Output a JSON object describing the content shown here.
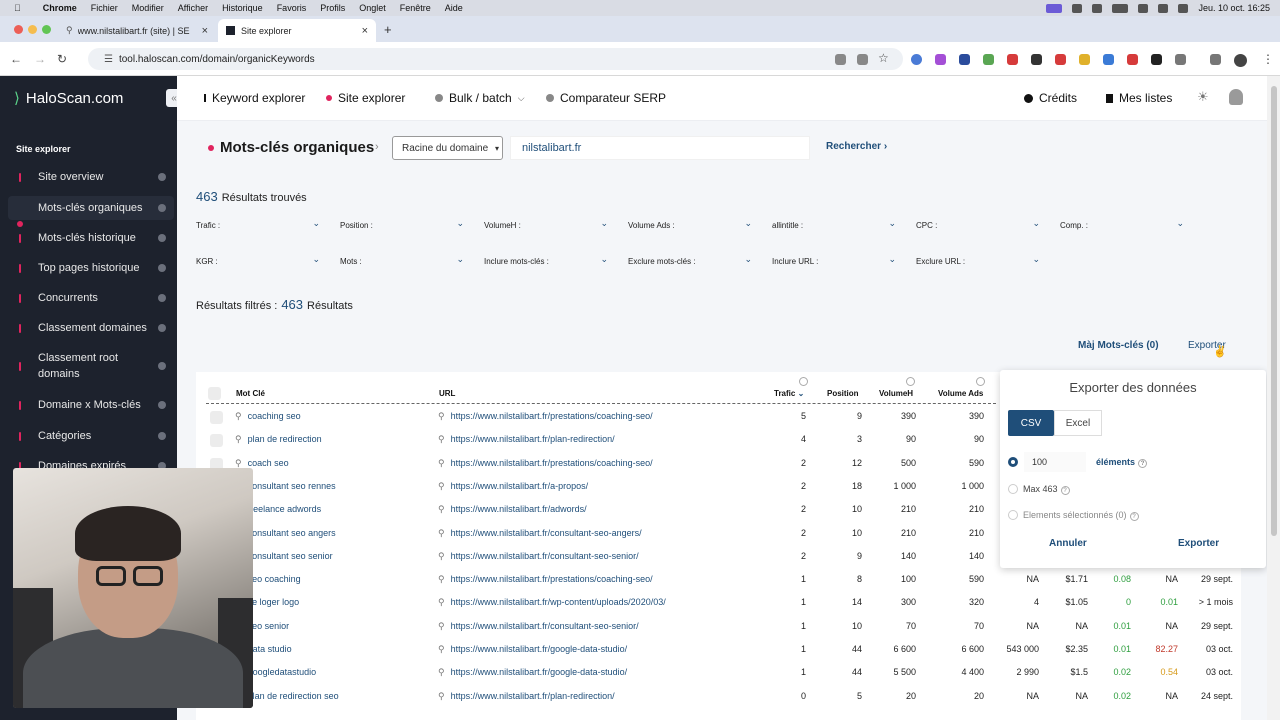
{
  "menubar": {
    "app": "Chrome",
    "items": [
      "Fichier",
      "Modifier",
      "Afficher",
      "Historique",
      "Favoris",
      "Profils",
      "Onglet",
      "Fenêtre",
      "Aide"
    ],
    "clock": "Jeu. 10 oct.  16:25"
  },
  "browser": {
    "tabs": [
      {
        "title": "www.nilstalibart.fr (site) | SEO"
      },
      {
        "title": "Site explorer"
      }
    ],
    "url": "tool.haloscan.com/domain/organicKeywords"
  },
  "sidebar": {
    "logo": "HaloScan.com",
    "section_title": "Site explorer",
    "items": [
      {
        "label": "Site overview"
      },
      {
        "label": "Mots-clés organiques"
      },
      {
        "label": "Mots-clés historique"
      },
      {
        "label": "Top pages historique"
      },
      {
        "label": "Concurrents"
      },
      {
        "label": "Classement domaines"
      },
      {
        "label": "Classement root domains"
      },
      {
        "label": "Domaine x Mots-clés"
      },
      {
        "label": "Catégories"
      },
      {
        "label": "Domaines expirés"
      }
    ]
  },
  "topnav": {
    "keyword_explorer": "Keyword explorer",
    "site_explorer": "Site explorer",
    "bulk": "Bulk / batch",
    "serp": "Comparateur SERP",
    "credits": "Crédits",
    "lists": "Mes listes"
  },
  "page": {
    "title": "Mots-clés organiques",
    "root_select": "Racine du domaine",
    "domain": "nilstalibart.fr",
    "search_label": "Rechercher",
    "results_count": "463",
    "results_label": "Résultats trouvés",
    "filtered_label": "Résultats filtrés :",
    "filtered_count": "463",
    "filtered_suffix": "Résultats",
    "maj_label": "Màj Mots-clés (0)",
    "export_label": "Exporter"
  },
  "filters": [
    "Trafic :",
    "Position :",
    "VolumeH :",
    "Volume Ads :",
    "allintitle :",
    "CPC :",
    "Comp. :",
    "KGR :",
    "Mots :",
    "Inclure mots-clés :",
    "Exclure mots-clés :",
    "Inclure URL :",
    "Exclure URL :"
  ],
  "table": {
    "headers": {
      "keyword": "Mot Clé",
      "url": "URL",
      "traffic": "Trafic",
      "position": "Position",
      "volumeh": "VolumeH",
      "volume_ads": "Volume Ads"
    },
    "rows": [
      {
        "kw": "coaching seo",
        "url": "https://www.nilstalibart.fr/prestations/coaching-seo/",
        "traffic": "5",
        "pos": "9",
        "vh": "390",
        "va": "390",
        "c1": "",
        "c2": "",
        "c3": "",
        "c4": "",
        "c5": "",
        "c6": ""
      },
      {
        "kw": "plan de redirection",
        "url": "https://www.nilstalibart.fr/plan-redirection/",
        "traffic": "4",
        "pos": "3",
        "vh": "90",
        "va": "90",
        "c1": "",
        "c2": "",
        "c3": "",
        "c4": "",
        "c5": "",
        "c6": ""
      },
      {
        "kw": "coach seo",
        "url": "https://www.nilstalibart.fr/prestations/coaching-seo/",
        "traffic": "2",
        "pos": "12",
        "vh": "500",
        "va": "590",
        "c1": "",
        "c2": "",
        "c3": "",
        "c4": "",
        "c5": "",
        "c6": ""
      },
      {
        "kw": "consultant seo rennes",
        "url": "https://www.nilstalibart.fr/a-propos/",
        "traffic": "2",
        "pos": "18",
        "vh": "1 000",
        "va": "1 000",
        "c1": "",
        "c2": "",
        "c3": "",
        "c4": "",
        "c5": "",
        "c6": ""
      },
      {
        "kw": "freelance adwords",
        "url": "https://www.nilstalibart.fr/adwords/",
        "traffic": "2",
        "pos": "10",
        "vh": "210",
        "va": "210",
        "c1": "",
        "c2": "",
        "c3": "",
        "c4": "",
        "c5": "",
        "c6": ""
      },
      {
        "kw": "consultant seo angers",
        "url": "https://www.nilstalibart.fr/consultant-seo-angers/",
        "traffic": "2",
        "pos": "10",
        "vh": "210",
        "va": "210",
        "c1": "",
        "c2": "",
        "c3": "",
        "c4": "",
        "c5": "",
        "c6": ""
      },
      {
        "kw": "consultant seo senior",
        "url": "https://www.nilstalibart.fr/consultant-seo-senior/",
        "traffic": "2",
        "pos": "9",
        "vh": "140",
        "va": "140",
        "c1": "",
        "c2": "",
        "c3": "",
        "c4": "",
        "c5": "",
        "c6": ""
      },
      {
        "kw": "seo coaching",
        "url": "https://www.nilstalibart.fr/prestations/coaching-seo/",
        "traffic": "1",
        "pos": "8",
        "vh": "100",
        "va": "590",
        "c1": "NA",
        "c2": "$1.71",
        "c3": "0.08",
        "c4": "NA",
        "c5": "29 sept.",
        "c6": ""
      },
      {
        "kw": "se loger logo",
        "url": "https://www.nilstalibart.fr/wp-content/uploads/2020/03/",
        "traffic": "1",
        "pos": "14",
        "vh": "300",
        "va": "320",
        "c1": "4",
        "c2": "$1.05",
        "c3": "0",
        "c4": "0.01",
        "c5": "> 1 mois",
        "c6": ""
      },
      {
        "kw": "seo senior",
        "url": "https://www.nilstalibart.fr/consultant-seo-senior/",
        "traffic": "1",
        "pos": "10",
        "vh": "70",
        "va": "70",
        "c1": "NA",
        "c2": "NA",
        "c3": "0.01",
        "c4": "NA",
        "c5": "29 sept.",
        "c6": ""
      },
      {
        "kw": "data studio",
        "url": "https://www.nilstalibart.fr/google-data-studio/",
        "traffic": "1",
        "pos": "44",
        "vh": "6 600",
        "va": "6 600",
        "c1": "543 000",
        "c2": "$2.35",
        "c3": "0.01",
        "c4": "82.27",
        "c5": "03 oct.",
        "c6": ""
      },
      {
        "kw": "googledatastudio",
        "url": "https://www.nilstalibart.fr/google-data-studio/",
        "traffic": "1",
        "pos": "44",
        "vh": "5 500",
        "va": "4 400",
        "c1": "2 990",
        "c2": "$1.5",
        "c3": "0.02",
        "c4": "0.54",
        "c5": "03 oct.",
        "c6": ""
      },
      {
        "kw": "plan de redirection seo",
        "url": "https://www.nilstalibart.fr/plan-redirection/",
        "traffic": "0",
        "pos": "5",
        "vh": "20",
        "va": "20",
        "c1": "NA",
        "c2": "NA",
        "c3": "0.02",
        "c4": "NA",
        "c5": "24 sept.",
        "c6": ""
      }
    ]
  },
  "export_popover": {
    "title": "Exporter des données",
    "csv": "CSV",
    "excel": "Excel",
    "count": "100",
    "elements_label": "éléments",
    "max_label": "Max 463",
    "selected_label": "Elements sélectionnés (0)",
    "cancel": "Annuler",
    "export": "Exporter"
  },
  "colors": {
    "accent": "#1f4e79",
    "pink": "#e0245e",
    "green": "#2e9e3e",
    "orange": "#d69a1a",
    "red": "#c0392b"
  }
}
